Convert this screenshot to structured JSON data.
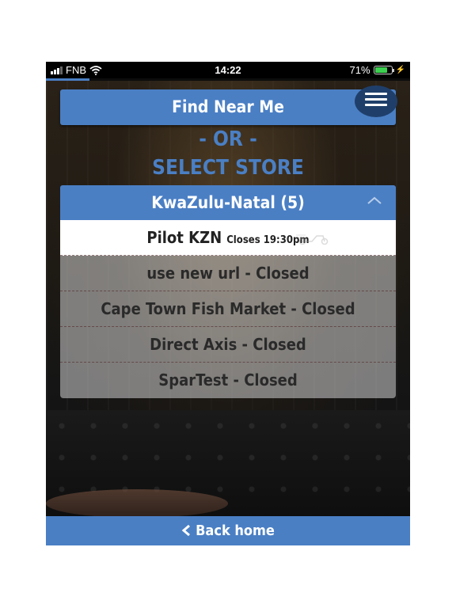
{
  "status_bar": {
    "carrier": "FNB",
    "time": "14:22",
    "battery_percent": "71%",
    "loading_progress": 0.12
  },
  "header": {
    "find_near_me_label": "Find Near Me",
    "or_label": "- OR -",
    "select_store_label": "SELECT STORE",
    "menu_icon": "hamburger-menu-icon"
  },
  "region": {
    "label": "KwaZulu-Natal (5)",
    "expanded": true,
    "icon": "chevron-up-icon"
  },
  "stores": [
    {
      "name": "Pilot KZN",
      "note": "Closes 19:30pm",
      "selected": true
    },
    {
      "name": "use new url - Closed"
    },
    {
      "name": "Cape Town Fish Market - Closed"
    },
    {
      "name": "Direct Axis - Closed"
    },
    {
      "name": "SparTest - Closed"
    }
  ],
  "footer": {
    "back_label": "Back home",
    "back_icon": "chevron-left-icon"
  },
  "colors": {
    "accent": "#4a7fc4",
    "menu_button": "#1f3f6a",
    "battery": "#3cd050"
  }
}
